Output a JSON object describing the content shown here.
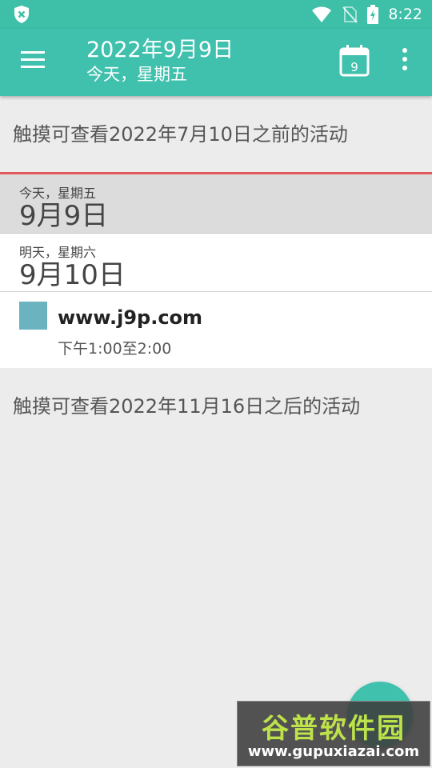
{
  "status_bar": {
    "time": "8:22",
    "left_icon": "shield-x-icon",
    "icons": [
      "wifi-icon",
      "no-sim-icon",
      "battery-charging-icon"
    ]
  },
  "app_bar": {
    "title": "2022年9月9日",
    "subtitle": "今天，星期五",
    "calendar_day": "9",
    "color": "#3fc1ad"
  },
  "list": {
    "earlier_text": "触摸可查看2022年7月10日之前的活动",
    "days": [
      {
        "small": "今天，星期五",
        "big": "9月9日"
      },
      {
        "small": "明天，星期六",
        "big": "9月10日"
      }
    ],
    "events": [
      {
        "title": "www.j9p.com",
        "time": "下午1:00至2:00",
        "color": "#6bb3bf"
      }
    ],
    "later_text": "触摸可查看2022年11月16日之后的活动"
  },
  "watermark": {
    "top": "谷普软件园",
    "bottom": "www.gupuxiazai.com"
  }
}
